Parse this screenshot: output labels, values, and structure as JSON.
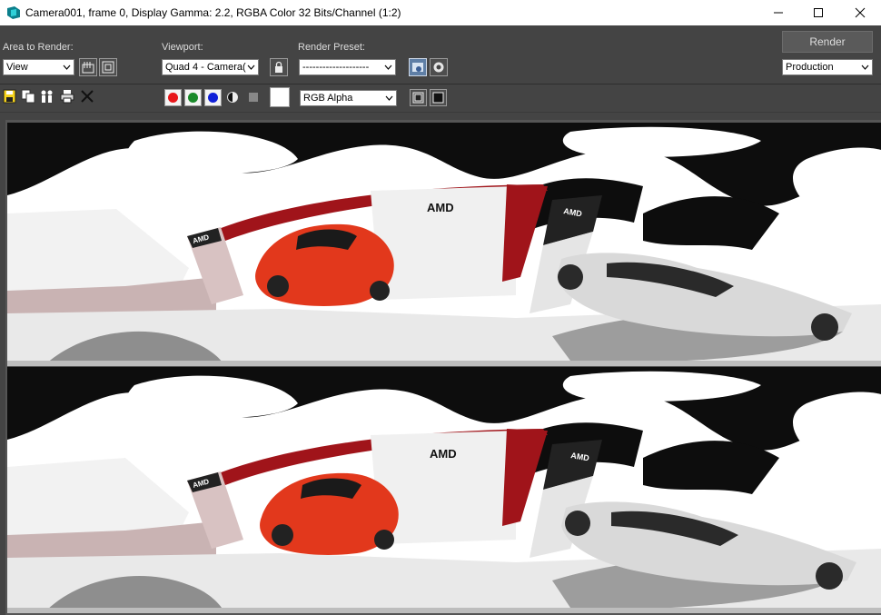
{
  "window": {
    "title": "Camera001, frame 0, Display Gamma: 2.2, RGBA Color 32 Bits/Channel (1:2)",
    "controls": [
      "minimize",
      "maximize",
      "close"
    ]
  },
  "toolbar": {
    "area_label": "Area to Render:",
    "area_value": "View",
    "viewport_label": "Viewport:",
    "viewport_value": "Quad 4 - Camera(",
    "preset_label": "Render Preset:",
    "preset_value": "--------------------",
    "render_label": "Render",
    "production_value": "Production",
    "channel_value": "RGB Alpha"
  },
  "colors": {
    "red_channel": "#e8171b",
    "green_channel": "#1a8a2a",
    "blue_channel": "#1020d8",
    "chrome_bg": "#444444",
    "title_bg": "#ffffff",
    "car_red": "#e2381c",
    "car_white": "#d9d9d9",
    "booth_red": "#a0141a"
  },
  "icons": [
    "app-icon",
    "region-icon",
    "crop-icon",
    "lock-icon",
    "environment-icon",
    "teapot-icon",
    "save-icon",
    "copy-icon",
    "clone-icon",
    "print-icon",
    "clear-icon",
    "mono-icon",
    "swatch-icon",
    "display-icon",
    "window-icon"
  ],
  "render": {
    "panels": [
      {
        "brand_left": "AMD",
        "brand_center": "AMD",
        "brand_right": "AMD"
      },
      {
        "brand_left": "AMD",
        "brand_center": "AMD",
        "brand_right": "AMD"
      }
    ]
  }
}
